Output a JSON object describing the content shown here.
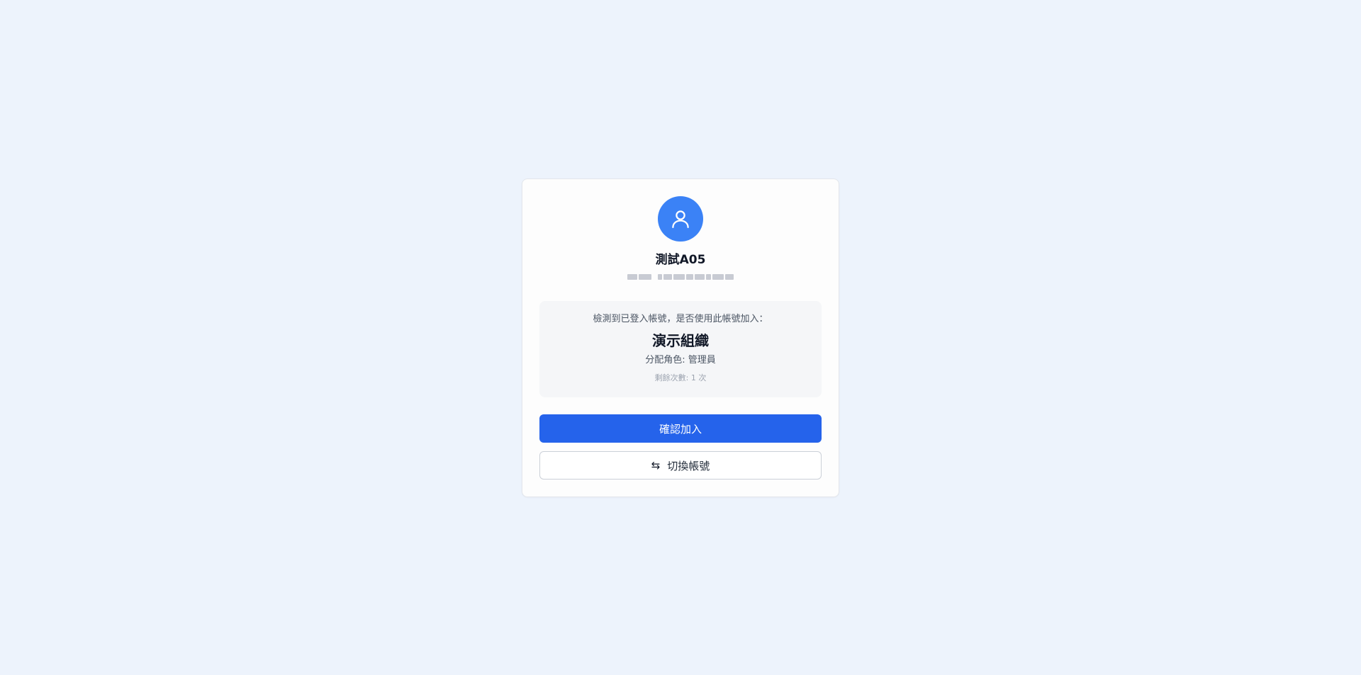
{
  "user": {
    "name": "測試A05",
    "avatar_icon": "user-icon",
    "accent_color": "#3b82f6"
  },
  "invite": {
    "prompt": "檢測到已登入帳號，是否使用此帳號加入：",
    "organization": "演示組織",
    "role_line": "分配角色: 管理員",
    "remaining_line": "剩餘次數: 1 次"
  },
  "actions": {
    "confirm_label": "確認加入",
    "confirm_color": "#2563eb",
    "switch_icon": "⇆",
    "switch_icon_name": "swap-icon",
    "switch_label": "切換帳號"
  }
}
